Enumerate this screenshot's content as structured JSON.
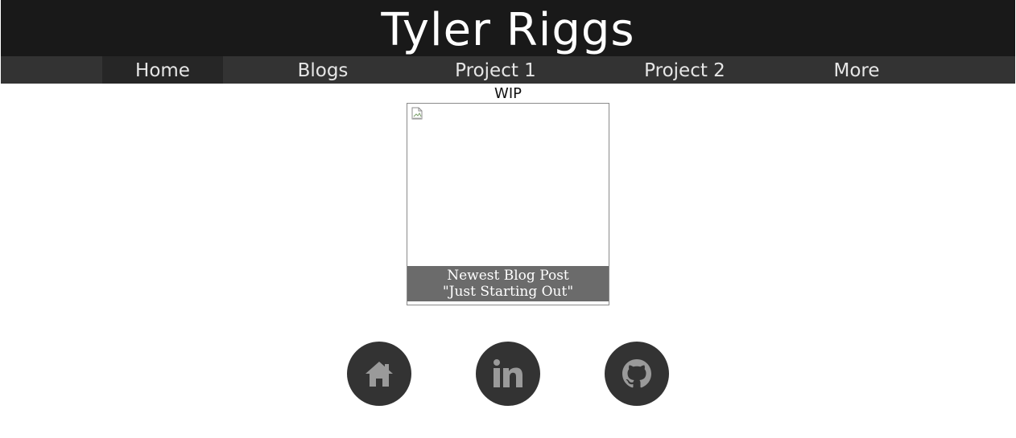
{
  "header": {
    "title": "Tyler Riggs"
  },
  "nav": {
    "items": [
      {
        "label": "Home"
      },
      {
        "label": "Blogs"
      },
      {
        "label": "Project 1"
      },
      {
        "label": "Project 2"
      },
      {
        "label": "More"
      }
    ],
    "active": "Home"
  },
  "main": {
    "status_label": "WIP",
    "featured_card": {
      "image_icon": "broken-image-icon",
      "caption_line1": "Newest Blog Post",
      "caption_line2": "\"Just Starting Out\""
    }
  },
  "footer": {
    "social_links": [
      {
        "icon": "home-icon"
      },
      {
        "icon": "linkedin-icon"
      },
      {
        "icon": "github-icon"
      }
    ]
  },
  "colors": {
    "header_bg": "#191919",
    "nav_bg": "#333333",
    "nav_active_bg": "#262626",
    "caption_bg": "#6b6b6b",
    "social_bg": "#333333",
    "icon_fill": "#9a9a9a"
  }
}
